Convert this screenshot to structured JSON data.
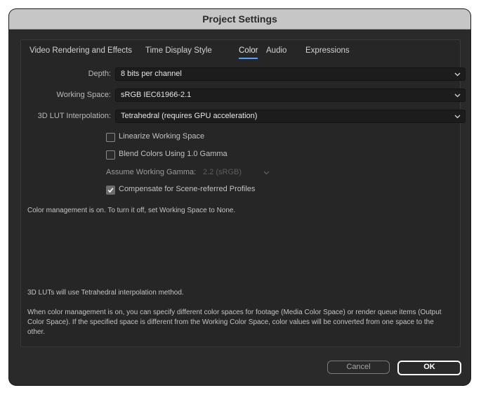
{
  "window": {
    "title": "Project Settings"
  },
  "tabs": [
    {
      "label": "Video Rendering and Effects"
    },
    {
      "label": "Time Display Style"
    },
    {
      "label": "Color"
    },
    {
      "label": "Audio"
    },
    {
      "label": "Expressions"
    }
  ],
  "active_tab": "Color",
  "fields": {
    "depth": {
      "label": "Depth:",
      "value": "8 bits per channel"
    },
    "working_space": {
      "label": "Working Space:",
      "value": "sRGB IEC61966-2.1"
    },
    "lut_interpolation": {
      "label": "3D LUT Interpolation:",
      "value": "Tetrahedral (requires GPU acceleration)"
    }
  },
  "checkboxes": {
    "linearize": {
      "label": "Linearize Working Space",
      "checked": false
    },
    "blend_gamma": {
      "label": "Blend Colors Using 1.0 Gamma",
      "checked": false
    },
    "compensate": {
      "label": "Compensate for Scene-referred Profiles",
      "checked": true
    }
  },
  "assume_gamma": {
    "label": "Assume Working Gamma:",
    "value": "2.2 (sRGB)",
    "enabled": false
  },
  "info": {
    "status": "Color management is on. To turn it off, set Working Space to None.",
    "lut_note": "3D LUTs will use Tetrahedral interpolation method.",
    "description_line1": "When color management is on, you can specify different color spaces for footage (Media Color Space) or render queue items (Output",
    "description_line2": "Color Space). If the specified space is different from the Working Color Space, color values will be converted from one space to the",
    "description_line3": "other."
  },
  "buttons": {
    "cancel": "Cancel",
    "ok": "OK"
  },
  "colors": {
    "window_bg": "#2a2a2a",
    "titlebar_bg": "#c6c6c6",
    "accent": "#4ea1ff"
  },
  "icons": {
    "dropdown": "chevron-down-icon",
    "check": "checkmark-icon"
  }
}
